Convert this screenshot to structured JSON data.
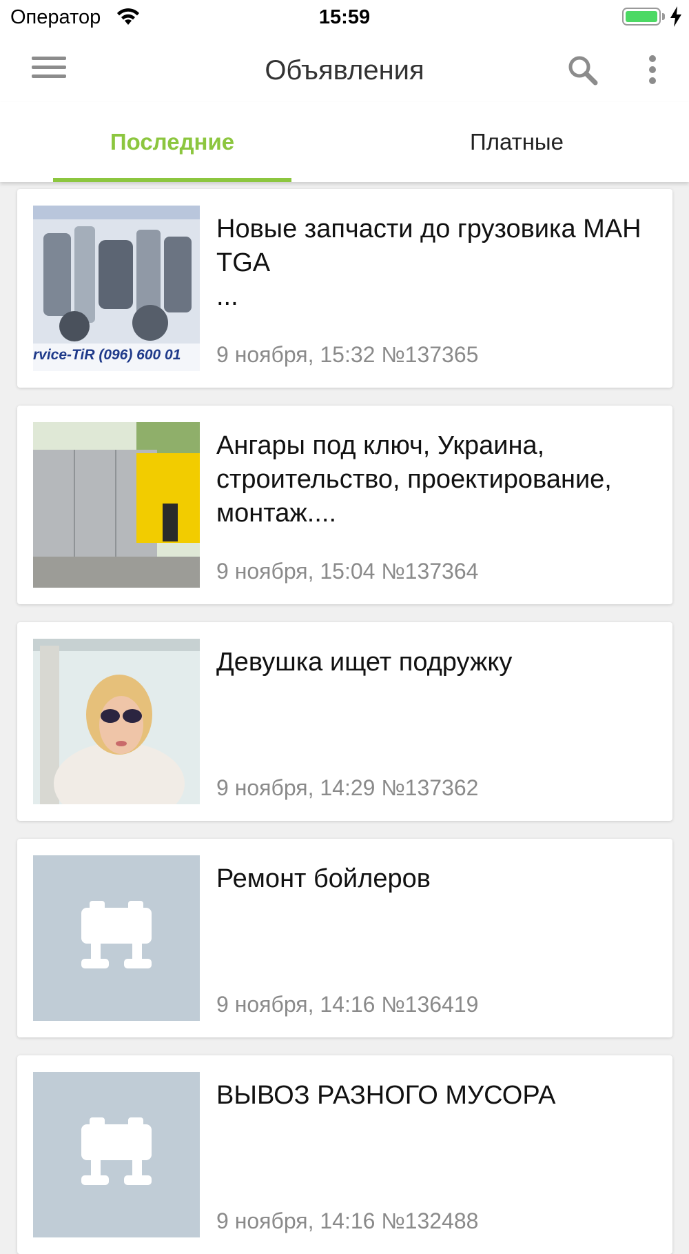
{
  "status_bar": {
    "carrier": "Оператор",
    "time": "15:59",
    "battery_level": 1.0,
    "charging": true
  },
  "app_bar": {
    "title": "Объявления",
    "menu_icon": "hamburger-menu-icon",
    "search_icon": "search-icon",
    "more_icon": "more-vertical-icon"
  },
  "tabs": [
    {
      "label": "Последние",
      "active": true
    },
    {
      "label": "Платные",
      "active": false
    }
  ],
  "colors": {
    "accent": "#8cc63f",
    "placeholder_bg": "#c0ccd6"
  },
  "listings": [
    {
      "title": "Новые запчасти до грузовика МАН TGA\n...",
      "meta": "9 ноября, 15:32 №137365",
      "image": "truck-parts-photo",
      "image_text": "rvice-TiR (096) 600 01"
    },
    {
      "title": "Ангары под ключ, Украина, строительство, проектирование, монтаж....",
      "meta": "9 ноября, 15:04 №137364",
      "image": "hangar-photo"
    },
    {
      "title": "Девушка ищет подружку",
      "meta": "9 ноября, 14:29 №137362",
      "image": "woman-photo"
    },
    {
      "title": "Ремонт бойлеров",
      "meta": "9 ноября, 14:16 №136419",
      "image": "placeholder-icon"
    },
    {
      "title": "ВЫВОЗ РАЗНОГО МУСОРА",
      "meta": "9 ноября, 14:16 №132488",
      "image": "placeholder-icon"
    }
  ]
}
